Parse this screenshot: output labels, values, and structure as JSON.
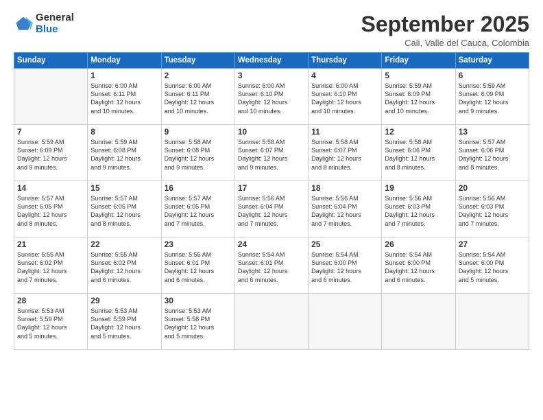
{
  "logo": {
    "general": "General",
    "blue": "Blue"
  },
  "header": {
    "month": "September 2025",
    "location": "Cali, Valle del Cauca, Colombia"
  },
  "days": [
    "Sunday",
    "Monday",
    "Tuesday",
    "Wednesday",
    "Thursday",
    "Friday",
    "Saturday"
  ],
  "weeks": [
    [
      {
        "day": "",
        "info": ""
      },
      {
        "day": "1",
        "info": "Sunrise: 6:00 AM\nSunset: 6:11 PM\nDaylight: 12 hours\nand 10 minutes."
      },
      {
        "day": "2",
        "info": "Sunrise: 6:00 AM\nSunset: 6:11 PM\nDaylight: 12 hours\nand 10 minutes."
      },
      {
        "day": "3",
        "info": "Sunrise: 6:00 AM\nSunset: 6:10 PM\nDaylight: 12 hours\nand 10 minutes."
      },
      {
        "day": "4",
        "info": "Sunrise: 6:00 AM\nSunset: 6:10 PM\nDaylight: 12 hours\nand 10 minutes."
      },
      {
        "day": "5",
        "info": "Sunrise: 5:59 AM\nSunset: 6:09 PM\nDaylight: 12 hours\nand 10 minutes."
      },
      {
        "day": "6",
        "info": "Sunrise: 5:59 AM\nSunset: 6:09 PM\nDaylight: 12 hours\nand 9 minutes."
      }
    ],
    [
      {
        "day": "7",
        "info": "Sunrise: 5:59 AM\nSunset: 6:09 PM\nDaylight: 12 hours\nand 9 minutes."
      },
      {
        "day": "8",
        "info": "Sunrise: 5:59 AM\nSunset: 6:08 PM\nDaylight: 12 hours\nand 9 minutes."
      },
      {
        "day": "9",
        "info": "Sunrise: 5:58 AM\nSunset: 6:08 PM\nDaylight: 12 hours\nand 9 minutes."
      },
      {
        "day": "10",
        "info": "Sunrise: 5:58 AM\nSunset: 6:07 PM\nDaylight: 12 hours\nand 9 minutes."
      },
      {
        "day": "11",
        "info": "Sunrise: 5:58 AM\nSunset: 6:07 PM\nDaylight: 12 hours\nand 8 minutes."
      },
      {
        "day": "12",
        "info": "Sunrise: 5:58 AM\nSunset: 6:06 PM\nDaylight: 12 hours\nand 8 minutes."
      },
      {
        "day": "13",
        "info": "Sunrise: 5:57 AM\nSunset: 6:06 PM\nDaylight: 12 hours\nand 8 minutes."
      }
    ],
    [
      {
        "day": "14",
        "info": "Sunrise: 5:57 AM\nSunset: 6:05 PM\nDaylight: 12 hours\nand 8 minutes."
      },
      {
        "day": "15",
        "info": "Sunrise: 5:57 AM\nSunset: 6:05 PM\nDaylight: 12 hours\nand 8 minutes."
      },
      {
        "day": "16",
        "info": "Sunrise: 5:57 AM\nSunset: 6:05 PM\nDaylight: 12 hours\nand 7 minutes."
      },
      {
        "day": "17",
        "info": "Sunrise: 5:56 AM\nSunset: 6:04 PM\nDaylight: 12 hours\nand 7 minutes."
      },
      {
        "day": "18",
        "info": "Sunrise: 5:56 AM\nSunset: 6:04 PM\nDaylight: 12 hours\nand 7 minutes."
      },
      {
        "day": "19",
        "info": "Sunrise: 5:56 AM\nSunset: 6:03 PM\nDaylight: 12 hours\nand 7 minutes."
      },
      {
        "day": "20",
        "info": "Sunrise: 5:56 AM\nSunset: 6:03 PM\nDaylight: 12 hours\nand 7 minutes."
      }
    ],
    [
      {
        "day": "21",
        "info": "Sunrise: 5:55 AM\nSunset: 6:02 PM\nDaylight: 12 hours\nand 7 minutes."
      },
      {
        "day": "22",
        "info": "Sunrise: 5:55 AM\nSunset: 6:02 PM\nDaylight: 12 hours\nand 6 minutes."
      },
      {
        "day": "23",
        "info": "Sunrise: 5:55 AM\nSunset: 6:01 PM\nDaylight: 12 hours\nand 6 minutes."
      },
      {
        "day": "24",
        "info": "Sunrise: 5:54 AM\nSunset: 6:01 PM\nDaylight: 12 hours\nand 6 minutes."
      },
      {
        "day": "25",
        "info": "Sunrise: 5:54 AM\nSunset: 6:00 PM\nDaylight: 12 hours\nand 6 minutes."
      },
      {
        "day": "26",
        "info": "Sunrise: 5:54 AM\nSunset: 6:00 PM\nDaylight: 12 hours\nand 6 minutes."
      },
      {
        "day": "27",
        "info": "Sunrise: 5:54 AM\nSunset: 6:00 PM\nDaylight: 12 hours\nand 5 minutes."
      }
    ],
    [
      {
        "day": "28",
        "info": "Sunrise: 5:53 AM\nSunset: 5:59 PM\nDaylight: 12 hours\nand 5 minutes."
      },
      {
        "day": "29",
        "info": "Sunrise: 5:53 AM\nSunset: 5:59 PM\nDaylight: 12 hours\nand 5 minutes."
      },
      {
        "day": "30",
        "info": "Sunrise: 5:53 AM\nSunset: 5:58 PM\nDaylight: 12 hours\nand 5 minutes."
      },
      {
        "day": "",
        "info": ""
      },
      {
        "day": "",
        "info": ""
      },
      {
        "day": "",
        "info": ""
      },
      {
        "day": "",
        "info": ""
      }
    ]
  ]
}
